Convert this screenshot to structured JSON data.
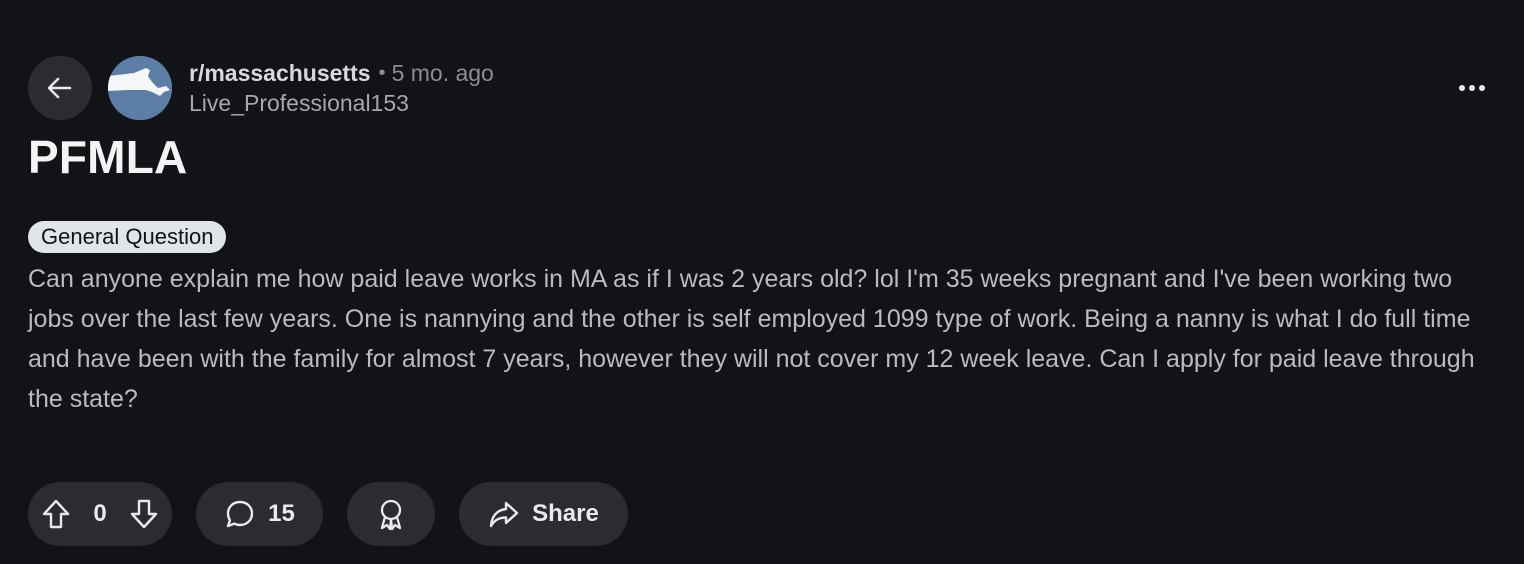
{
  "post": {
    "subreddit": "r/massachusetts",
    "separator": "•",
    "time_ago": "5 mo. ago",
    "author": "Live_Professional153",
    "title": "PFMLA",
    "flair": "General Question",
    "body": "Can anyone explain me how paid leave works in MA as if I was 2 years old? lol I'm 35 weeks pregnant and I've been working two jobs over the last few years. One is nannying and the other is self employed 1099 type of work. Being a nanny is what I do full time and have been with the family for almost 7 years, however they will not cover my 12 week leave. Can I apply for paid leave through the state?"
  },
  "actions": {
    "score": "0",
    "comment_count": "15",
    "share_label": "Share"
  },
  "icons": {
    "back": "arrow-left-icon",
    "more": "ellipsis-icon",
    "upvote": "arrow-up-icon",
    "downvote": "arrow-down-icon",
    "comment": "speech-bubble-icon",
    "award": "award-ribbon-icon",
    "share": "share-arrow-icon"
  },
  "colors": {
    "background": "#121316",
    "button_bg": "#2a2c30",
    "flair_bg": "#e1e4e8",
    "avatar_bg": "#5b7da6"
  }
}
